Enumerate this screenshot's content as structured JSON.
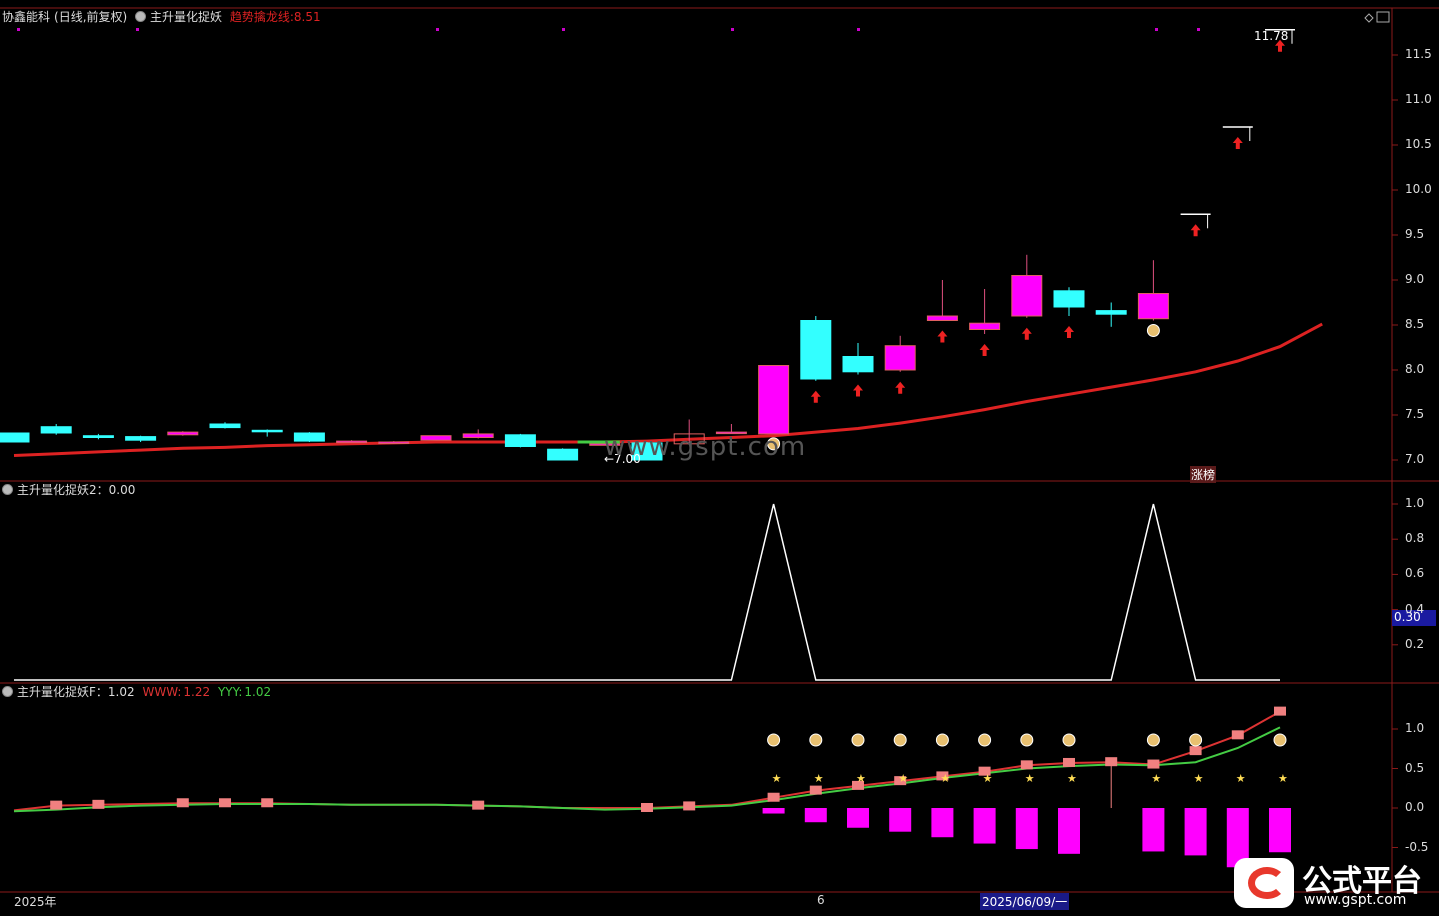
{
  "header1": {
    "stock": "协鑫能科",
    "period": "(日线,前复权)",
    "indicator": "主升量化捉妖",
    "line_label": "趋势擒龙线:",
    "line_value": "8.51"
  },
  "header2": {
    "indicator": "主升量化捉妖2",
    "value": "：0.00"
  },
  "header3": {
    "indicator": "主升量化捉妖F",
    "value": "：1.02",
    "www_label": "WWW:",
    "www_value": "1.22",
    "yyy_label": "YYY:",
    "yyy_value": "1.02"
  },
  "annotations": {
    "high": "11.78",
    "low": "←7.00",
    "limit": "涨榜",
    "highlight": "0.30"
  },
  "watermark": "www.gspt.com",
  "x_axis": {
    "year": "2025年",
    "month": "6",
    "cursor_date": "2025/06/09/一"
  },
  "logo": {
    "name": "公式平台",
    "url": "www.gspt.com"
  },
  "axis1": [
    "11.5",
    "11.0",
    "10.5",
    "10.0",
    "9.5",
    "9.0",
    "8.5",
    "8.0",
    "7.5",
    "7.0"
  ],
  "axis2": [
    "1.0",
    "0.8",
    "0.6",
    "0.4",
    "0.2"
  ],
  "axis3": [
    "1.0",
    "0.5",
    "0.0",
    "-0.5"
  ],
  "colors": {
    "up": "#ff00ff",
    "down": "#33ffff",
    "trend": "#dd2222",
    "www": "#dd3333",
    "yyy": "#44cc44",
    "bar": "#ff00ff",
    "marker": "#f08080"
  },
  "chart_data": {
    "type": "candlestick",
    "candles": [
      {
        "o": 7.3,
        "c": 7.2,
        "h": 7.3,
        "l": 7.2
      },
      {
        "o": 7.37,
        "c": 7.3,
        "h": 7.4,
        "l": 7.28
      },
      {
        "o": 7.27,
        "c": 7.25,
        "h": 7.29,
        "l": 7.23
      },
      {
        "o": 7.26,
        "c": 7.22,
        "h": 7.27,
        "l": 7.2
      },
      {
        "o": 7.28,
        "c": 7.31,
        "h": 7.32,
        "l": 7.27
      },
      {
        "o": 7.4,
        "c": 7.36,
        "h": 7.42,
        "l": 7.35
      },
      {
        "o": 7.33,
        "c": 7.32,
        "h": 7.34,
        "l": 7.26
      },
      {
        "o": 7.3,
        "c": 7.21,
        "h": 7.31,
        "l": 7.2
      },
      {
        "o": 7.21,
        "c": 7.21,
        "h": 7.22,
        "l": 7.2
      },
      {
        "o": 7.2,
        "c": 7.2,
        "h": 7.21,
        "l": 7.19
      },
      {
        "o": 7.22,
        "c": 7.27,
        "h": 7.27,
        "l": 7.22
      },
      {
        "o": 7.25,
        "c": 7.29,
        "h": 7.34,
        "l": 7.24
      },
      {
        "o": 7.28,
        "c": 7.15,
        "h": 7.29,
        "l": 7.14
      },
      {
        "o": 7.12,
        "c": 7.0,
        "h": 7.13,
        "l": 7.0
      },
      {
        "o": 7.18,
        "c": 7.18,
        "h": 7.2,
        "l": 7.17
      },
      {
        "o": 7.19,
        "c": 7.0,
        "h": 7.2,
        "l": 7.0
      },
      {
        "o": 7.18,
        "c": 7.29,
        "h": 7.45,
        "l": 7.17
      },
      {
        "o": 7.31,
        "c": 7.31,
        "h": 7.4,
        "l": 7.29
      },
      {
        "o": 7.29,
        "c": 8.05,
        "h": 8.05,
        "l": 7.29
      },
      {
        "o": 8.55,
        "c": 7.9,
        "h": 8.6,
        "l": 7.88
      },
      {
        "o": 8.15,
        "c": 7.98,
        "h": 8.3,
        "l": 7.95
      },
      {
        "o": 8.0,
        "c": 8.27,
        "h": 8.38,
        "l": 7.98
      },
      {
        "o": 8.55,
        "c": 8.6,
        "h": 9.0,
        "l": 8.55
      },
      {
        "o": 8.45,
        "c": 8.52,
        "h": 8.9,
        "l": 8.4
      },
      {
        "o": 8.6,
        "c": 9.05,
        "h": 9.28,
        "l": 8.58
      },
      {
        "o": 8.88,
        "c": 8.7,
        "h": 8.92,
        "l": 8.6
      },
      {
        "o": 8.66,
        "c": 8.62,
        "h": 8.75,
        "l": 8.48
      },
      {
        "o": 8.57,
        "c": 8.85,
        "h": 9.22,
        "l": 8.55
      },
      {
        "o": 9.73,
        "c": 9.73,
        "h": 9.73,
        "l": 9.73
      },
      {
        "o": 10.7,
        "c": 10.7,
        "h": 10.7,
        "l": 10.7
      },
      {
        "o": 11.78,
        "c": 11.78,
        "h": 11.78,
        "l": 11.78
      }
    ],
    "trend_line": [
      7.05,
      7.07,
      7.09,
      7.11,
      7.13,
      7.14,
      7.16,
      7.17,
      7.18,
      7.19,
      7.2,
      7.2,
      7.2,
      7.2,
      7.2,
      7.21,
      7.23,
      7.25,
      7.27,
      7.31,
      7.35,
      7.41,
      7.48,
      7.56,
      7.65,
      7.73,
      7.81,
      7.89,
      7.98,
      8.1,
      8.26,
      8.51
    ],
    "signal2": [
      0,
      0,
      0,
      0,
      0,
      0,
      0,
      0,
      0,
      0,
      0,
      0,
      0,
      0,
      0,
      0,
      0,
      0,
      1,
      0,
      0,
      0,
      0,
      0,
      0,
      0,
      0,
      1,
      0,
      0,
      0
    ],
    "www": [
      -0.03,
      0.03,
      0.04,
      0.05,
      0.06,
      0.06,
      0.06,
      0.05,
      0.04,
      0.04,
      0.04,
      0.03,
      0.02,
      0.0,
      0.0,
      0.0,
      0.02,
      0.04,
      0.13,
      0.22,
      0.28,
      0.34,
      0.4,
      0.46,
      0.54,
      0.57,
      0.58,
      0.55,
      0.72,
      0.92,
      1.22
    ],
    "yyy": [
      -0.04,
      -0.02,
      0.01,
      0.03,
      0.04,
      0.05,
      0.05,
      0.05,
      0.04,
      0.04,
      0.04,
      0.03,
      0.02,
      0.0,
      -0.02,
      -0.01,
      0.01,
      0.03,
      0.1,
      0.18,
      0.25,
      0.31,
      0.38,
      0.44,
      0.5,
      0.53,
      0.55,
      0.54,
      0.58,
      0.76,
      1.02
    ],
    "bars": [
      0,
      0,
      0,
      0,
      0,
      0,
      0,
      0,
      0,
      0,
      0,
      0,
      0,
      0,
      0,
      0,
      0,
      0,
      -0.07,
      -0.18,
      -0.25,
      -0.3,
      -0.37,
      -0.45,
      -0.52,
      -0.58,
      0,
      -0.55,
      -0.6,
      -0.75,
      -0.56
    ],
    "money_idx": [
      18,
      19,
      20,
      21,
      22,
      23,
      24,
      25,
      27,
      28,
      30
    ],
    "star_idx": [
      18,
      19,
      20,
      21,
      22,
      23,
      24,
      25,
      27,
      28,
      29,
      30
    ]
  }
}
